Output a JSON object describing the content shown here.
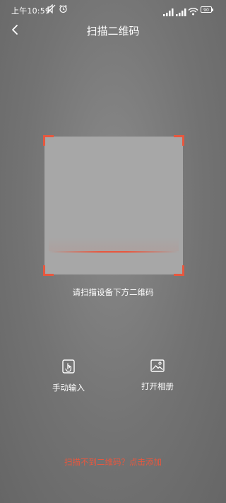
{
  "status_bar": {
    "time": "上午10:59",
    "icons": [
      "mute-icon",
      "alarm-icon",
      "signal-icon",
      "signal-icon",
      "wifi-icon",
      "battery-icon"
    ],
    "battery": "90"
  },
  "header": {
    "title": "扫描二维码",
    "back_icon": "chevron-left-icon"
  },
  "scanner": {
    "accent_color": "#e8573e",
    "hint": "请扫描设备下方二维码"
  },
  "actions": {
    "manual": {
      "label": "手动输入",
      "icon": "hand-tap-icon"
    },
    "album": {
      "label": "打开相册",
      "icon": "image-icon"
    }
  },
  "footer": {
    "add_link": "扫描不到二维码？点击添加"
  }
}
